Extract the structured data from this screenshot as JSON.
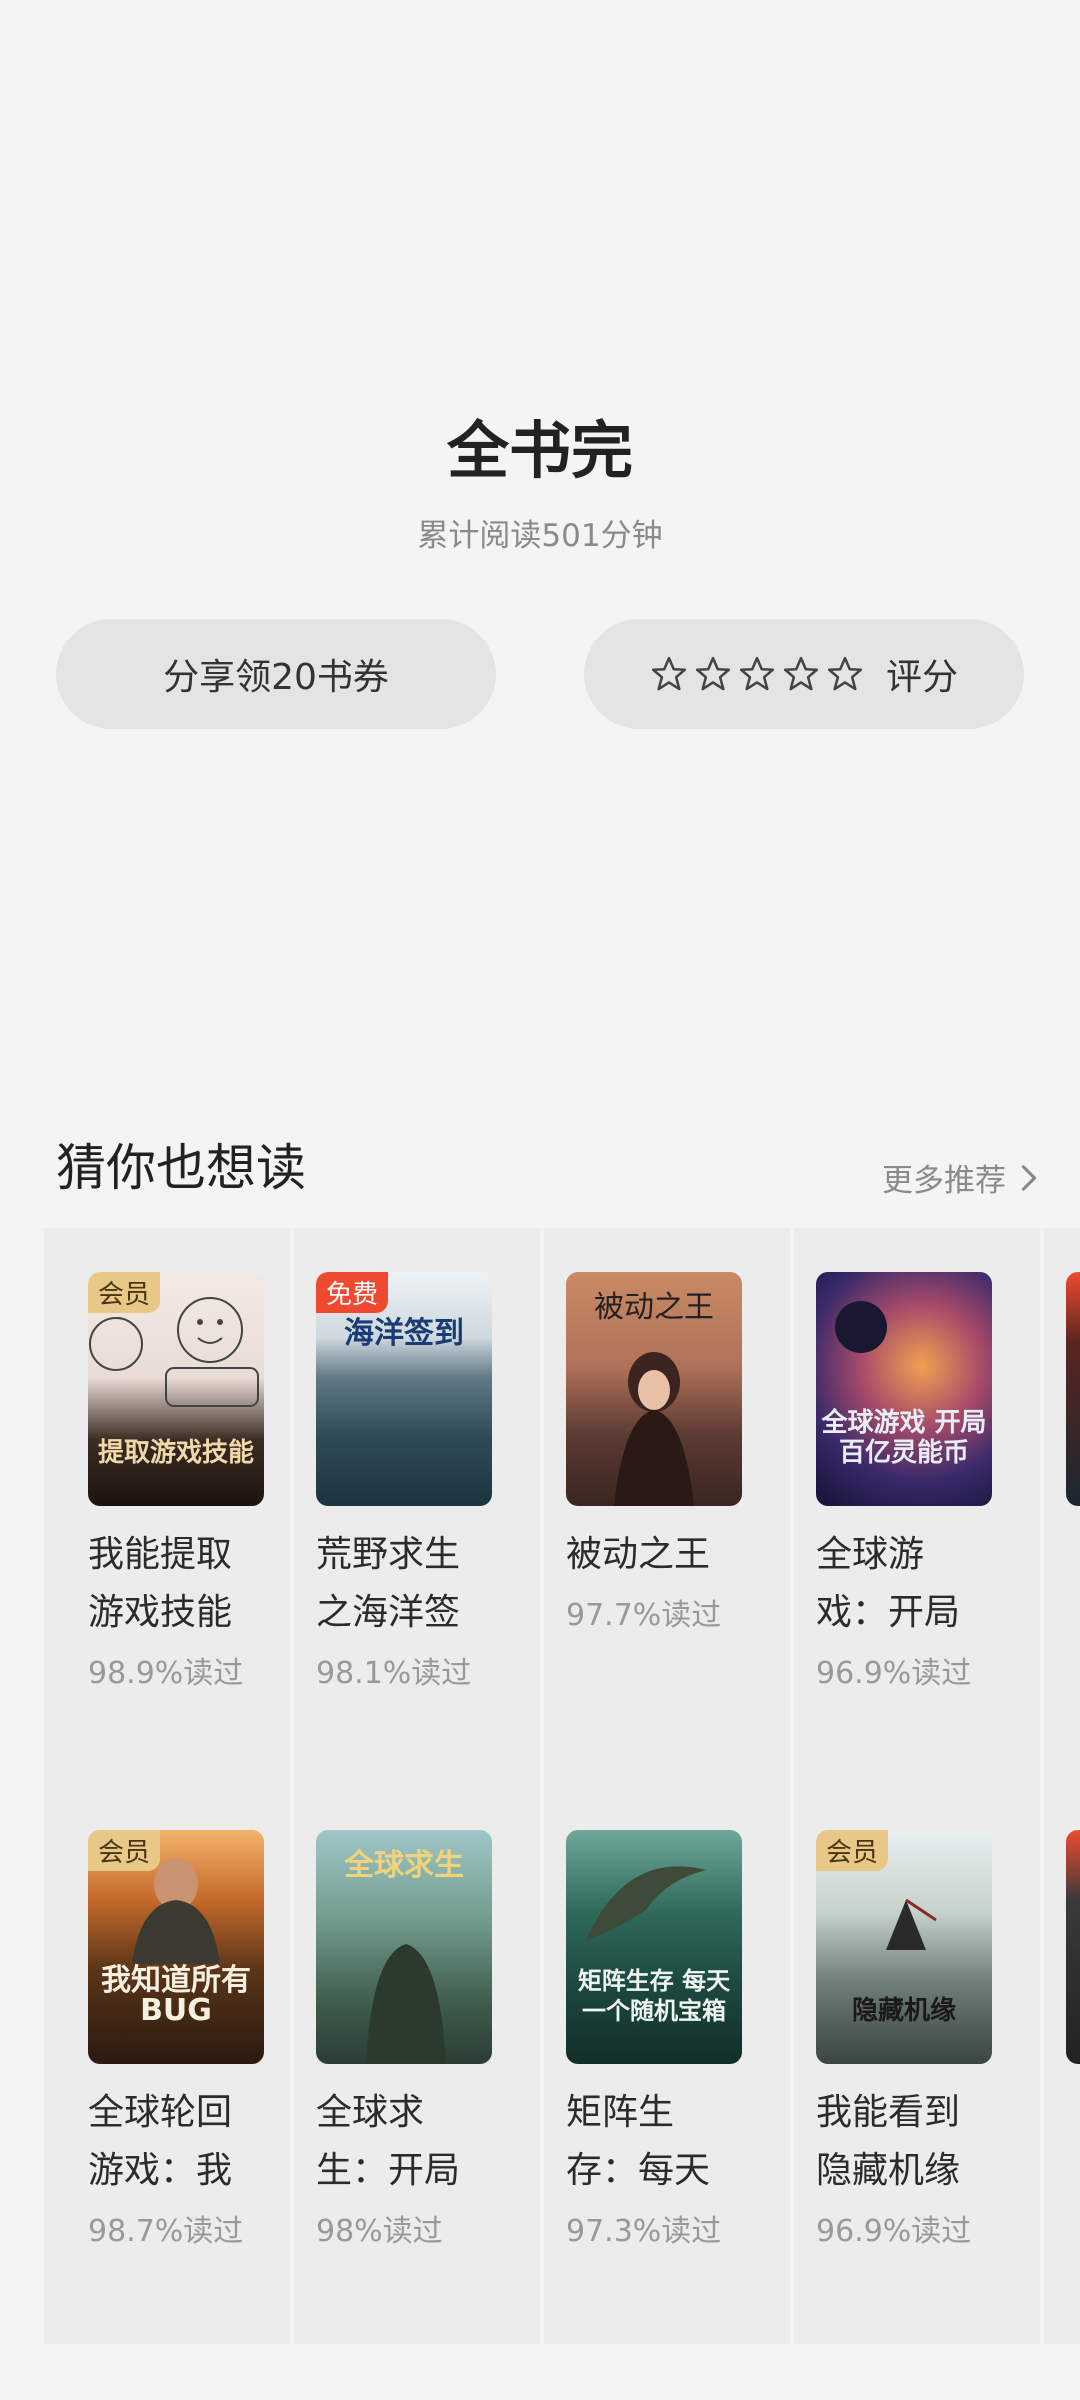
{
  "finish": {
    "title": "全书完",
    "subtitle": "累计阅读501分钟",
    "share_label": "分享领20书券",
    "rate_label": "评分",
    "stars": [
      "star-icon",
      "star-icon",
      "star-icon",
      "star-icon",
      "star-icon"
    ]
  },
  "recommend": {
    "title": "猜你也想读",
    "more_label": "更多推荐"
  },
  "books": [
    {
      "name": "我能提取游戏技能",
      "pct": "98.9%读过",
      "badge": "会员",
      "cover_text": "提取游戏技能"
    },
    {
      "name": "荒野求生之海洋签",
      "pct": "98.1%读过",
      "badge": "免费",
      "cover_text": "海洋签到"
    },
    {
      "name": "被动之王",
      "pct": "97.7%读过",
      "badge": "",
      "cover_text": "被动之王"
    },
    {
      "name": "全球游戏：开局",
      "pct": "96.9%读过",
      "badge": "",
      "cover_text": "全球游戏 开局百亿灵能币"
    },
    {
      "name": "全球轮回游戏：我",
      "pct": "98.7%读过",
      "badge": "会员",
      "cover_text": "我知道所有BUG"
    },
    {
      "name": "全球求生：开局",
      "pct": "98%读过",
      "badge": "",
      "cover_text": "全球求生"
    },
    {
      "name": "矩阵生存：每天",
      "pct": "97.3%读过",
      "badge": "",
      "cover_text": "矩阵生存 每天一个随机宝箱"
    },
    {
      "name": "我能看到隐藏机缘",
      "pct": "96.9%读过",
      "badge": "会员",
      "cover_text": "隐藏机缘"
    }
  ],
  "colors": {
    "background": "#f4f4f4",
    "card": "#ececec",
    "pill": "#e4e4e4",
    "vip_badge": "#e8c886",
    "free_badge": "#ef4a2f"
  }
}
